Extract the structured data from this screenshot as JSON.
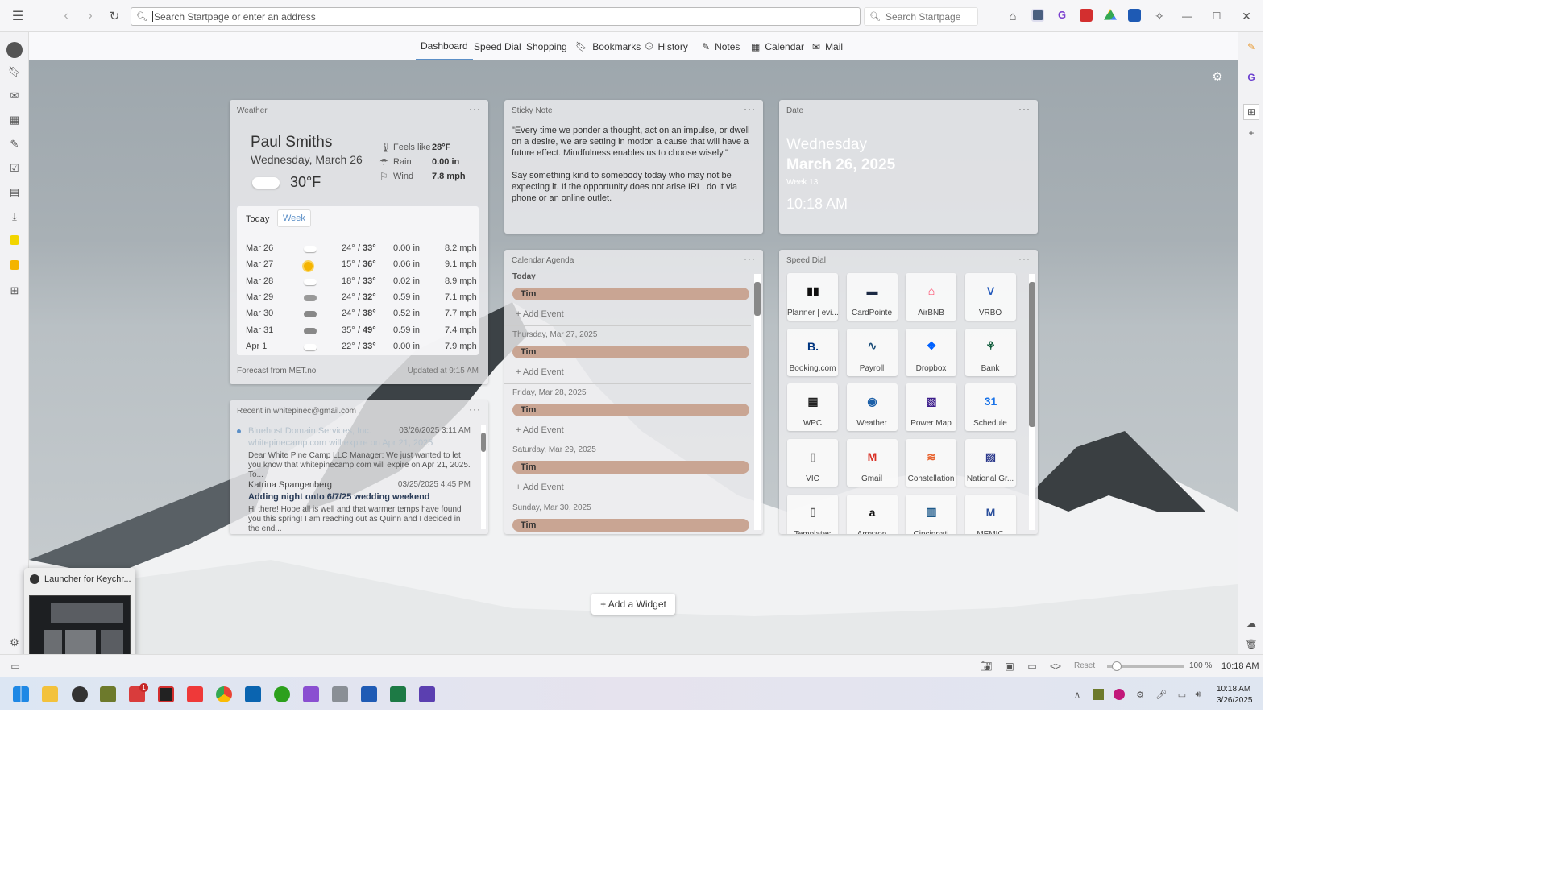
{
  "browser": {
    "address_placeholder": "Search Startpage or enter an address",
    "search_placeholder": "Search Startpage"
  },
  "tabs": [
    "Dashboard",
    "Speed Dial",
    "Shopping",
    "Bookmarks",
    "History",
    "Notes",
    "Calendar",
    "Mail"
  ],
  "weather": {
    "title": "Weather",
    "location": "Paul Smiths",
    "date": "Wednesday, March 26",
    "temp": "30°F",
    "feels_label": "Feels like",
    "feels": "28°F",
    "rain_label": "Rain",
    "rain": "0.00 in",
    "wind_label": "Wind",
    "wind": "7.8 mph",
    "tab_today": "Today",
    "tab_week": "Week",
    "forecast": [
      {
        "d": "Mar 26",
        "lo": "24°",
        "hi": "33°",
        "p": "0.00 in",
        "w": "8.2 mph",
        "icon": "cloud"
      },
      {
        "d": "Mar 27",
        "lo": "15°",
        "hi": "36°",
        "p": "0.06 in",
        "w": "9.1 mph",
        "icon": "sun"
      },
      {
        "d": "Mar 28",
        "lo": "18°",
        "hi": "33°",
        "p": "0.02 in",
        "w": "8.9 mph",
        "icon": "cloud"
      },
      {
        "d": "Mar 29",
        "lo": "24°",
        "hi": "32°",
        "p": "0.59 in",
        "w": "7.1 mph",
        "icon": "snow"
      },
      {
        "d": "Mar 30",
        "lo": "24°",
        "hi": "38°",
        "p": "0.52 in",
        "w": "7.7 mph",
        "icon": "rain"
      },
      {
        "d": "Mar 31",
        "lo": "35°",
        "hi": "49°",
        "p": "0.59 in",
        "w": "7.4 mph",
        "icon": "rain"
      },
      {
        "d": "Apr 1",
        "lo": "22°",
        "hi": "33°",
        "p": "0.00 in",
        "w": "7.9 mph",
        "icon": "cloud"
      }
    ],
    "source": "Forecast from MET.no",
    "updated": "Updated at 9:15 AM"
  },
  "sticky": {
    "title": "Sticky Note",
    "p1": "\"Every time we ponder a thought, act on an impulse, or dwell on a desire, we are setting in motion a cause that will have a future effect. Mindfulness enables us to choose wisely.\"",
    "p2": "Say something kind to somebody today who may not be expecting it. If the opportunity does not arise IRL, do it via phone or an online outlet."
  },
  "date": {
    "title": "Date",
    "weekday": "Wednesday",
    "full": "March 26, 2025",
    "week": "Week 13",
    "time": "10:18 AM"
  },
  "mail": {
    "title": "Recent in whitepinec@gmail.com",
    "items": [
      {
        "from": "Bluehost Domain Services, Inc.",
        "time": "03/26/2025 3:11 AM",
        "subject": "whitepinecamp.com will expire on Apr 21, 2025",
        "body": "Dear White Pine Camp LLC Manager: We just wanted to let you know that whitepinecamp.com will expire on Apr 21, 2025. To..."
      },
      {
        "from": "Katrina Spangenberg",
        "time": "03/25/2025 4:45 PM",
        "subject": "Adding night onto 6/7/25 wedding weekend",
        "body": "Hi there! Hope all is well and that warmer temps have found you this spring! I am reaching out as Quinn and I decided in the end..."
      }
    ]
  },
  "calendar": {
    "title": "Calendar Agenda",
    "today": "Today",
    "event": "Tim",
    "add": "+ Add Event",
    "days": [
      "Thursday,   Mar 27, 2025",
      "Friday,   Mar 28, 2025",
      "Saturday,   Mar 29, 2025",
      "Sunday,   Mar 30, 2025"
    ]
  },
  "speed_dial": {
    "title": "Speed Dial",
    "items": [
      {
        "label": "Planner | evi...",
        "color": "#111",
        "glyph": "▮▮"
      },
      {
        "label": "CardPointe",
        "color": "#1b2a44",
        "glyph": "▬"
      },
      {
        "label": "AirBNB",
        "color": "#ff385c",
        "glyph": "⌂"
      },
      {
        "label": "VRBO",
        "color": "#245abc",
        "glyph": "V"
      },
      {
        "label": "Booking.com",
        "color": "#003580",
        "glyph": "B."
      },
      {
        "label": "Payroll",
        "color": "#1d4f7a",
        "glyph": "∿"
      },
      {
        "label": "Dropbox",
        "color": "#0061ff",
        "glyph": "❖"
      },
      {
        "label": "Bank",
        "color": "#0e5b3a",
        "glyph": "⚘"
      },
      {
        "label": "WPC",
        "color": "#222",
        "glyph": "▦"
      },
      {
        "label": "Weather",
        "color": "#1b5fa8",
        "glyph": "◉"
      },
      {
        "label": "Power Map",
        "color": "#3b1c8a",
        "glyph": "▧"
      },
      {
        "label": "Schedule",
        "color": "#1a73e8",
        "glyph": "31"
      },
      {
        "label": "VIC",
        "color": "#666",
        "glyph": "▯"
      },
      {
        "label": "Gmail",
        "color": "#d93025",
        "glyph": "M"
      },
      {
        "label": "Constellation",
        "color": "#e8612c",
        "glyph": "≋"
      },
      {
        "label": "National Gr...",
        "color": "#2d3a8c",
        "glyph": "▨"
      },
      {
        "label": "Templates",
        "color": "#666",
        "glyph": "▯"
      },
      {
        "label": "Amazon",
        "color": "#111",
        "glyph": "a"
      },
      {
        "label": "Cincinnati",
        "color": "#1e5a8a",
        "glyph": "▥"
      },
      {
        "label": "MEMIC",
        "color": "#2a4e9b",
        "glyph": "M"
      }
    ]
  },
  "add_widget": "+ Add a Widget",
  "launcher": "Launcher for Keychr...",
  "status": {
    "reset": "Reset",
    "zoom": "100 %",
    "time": "10:18 AM"
  },
  "clock": {
    "time": "10:18 AM",
    "date": "3/26/2025"
  },
  "taskbar_badge": "1"
}
